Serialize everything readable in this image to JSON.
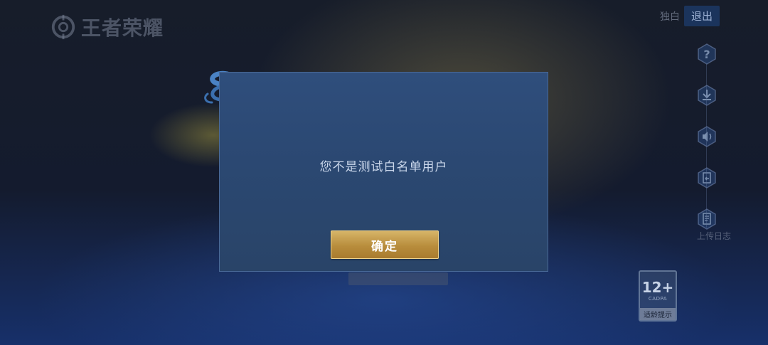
{
  "logo": {
    "text": "王者荣耀"
  },
  "header": {
    "solo_label": "独白",
    "exit_label": "退出"
  },
  "side_menu": {
    "items": [
      {
        "icon": "help-icon"
      },
      {
        "icon": "download-icon"
      },
      {
        "icon": "volume-icon"
      },
      {
        "icon": "switch-account-icon"
      },
      {
        "icon": "log-icon"
      }
    ],
    "upload_log_label": "上传日志"
  },
  "age_rating": {
    "number": "12+",
    "org": "CADPA",
    "label": "适龄提示"
  },
  "dialog": {
    "message": "您不是测试白名单用户",
    "confirm_label": "确定"
  },
  "colors": {
    "dialog_bg": "#2d4a76",
    "dialog_border": "#4a6a98",
    "confirm_gold": "#c49a4a",
    "message_text": "#c9d6ea"
  }
}
